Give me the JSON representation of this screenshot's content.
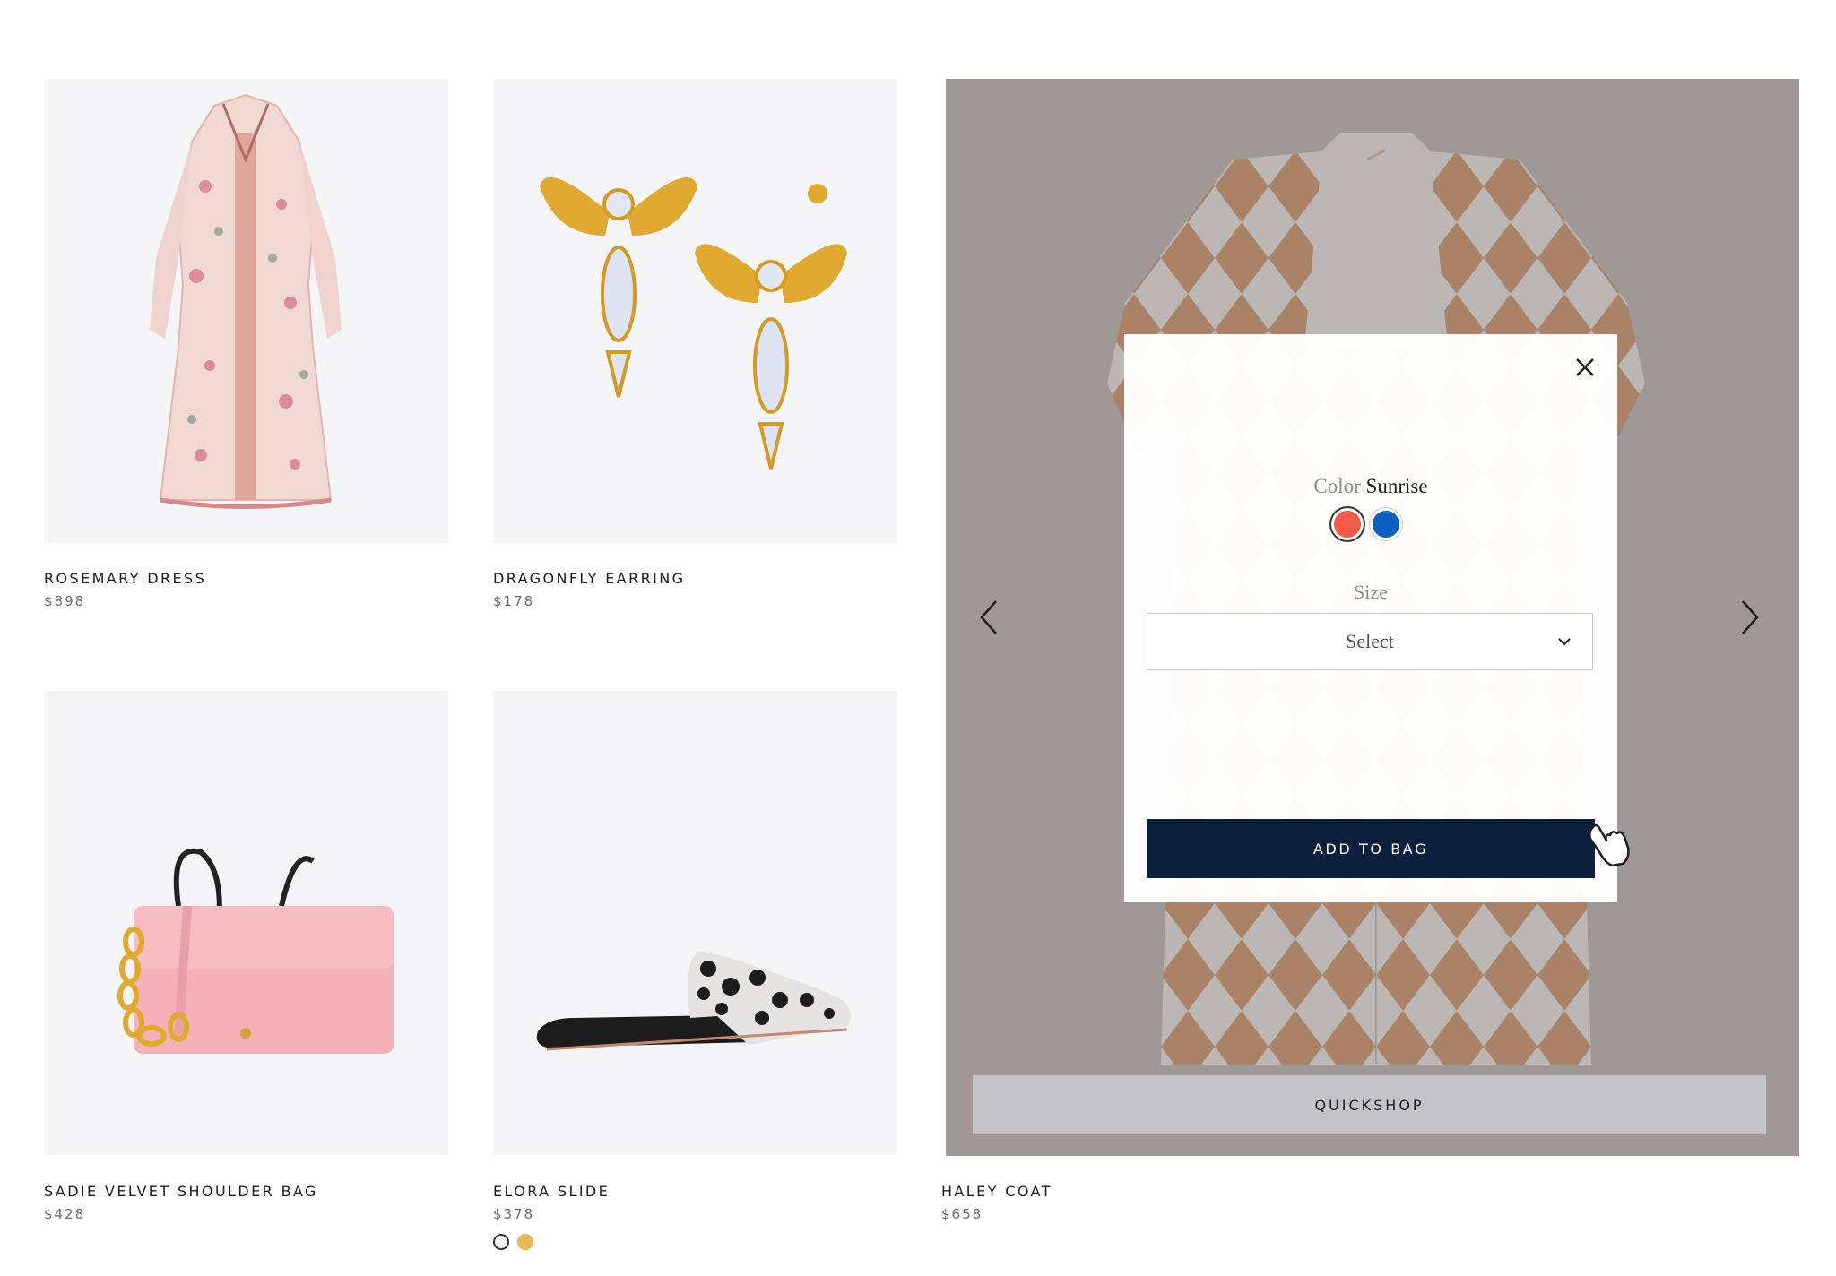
{
  "products": [
    {
      "name": "ROSEMARY DRESS",
      "price": "$898"
    },
    {
      "name": "DRAGONFLY EARRING",
      "price": "$178"
    },
    {
      "name": "SADIE VELVET SHOULDER BAG",
      "price": "$428"
    },
    {
      "name": "ELORA SLIDE",
      "price": "$378"
    },
    {
      "name": "HALEY COAT",
      "price": "$658"
    }
  ],
  "quickshop_label": "QUICKSHOP",
  "modal": {
    "color_label": "Color",
    "color_value": "Sunrise",
    "swatches": [
      {
        "name": "Sunrise",
        "color": "#ef5b48",
        "selected": true
      },
      {
        "name": "Blue",
        "color": "#0c5fbd",
        "selected": false
      }
    ],
    "size_label": "Size",
    "size_select": "Select",
    "add_to_bag": "ADD TO BAG"
  },
  "colors": {
    "add_to_bag_bg": "#0c1f3d",
    "coat_orange": "#c06a2a"
  }
}
